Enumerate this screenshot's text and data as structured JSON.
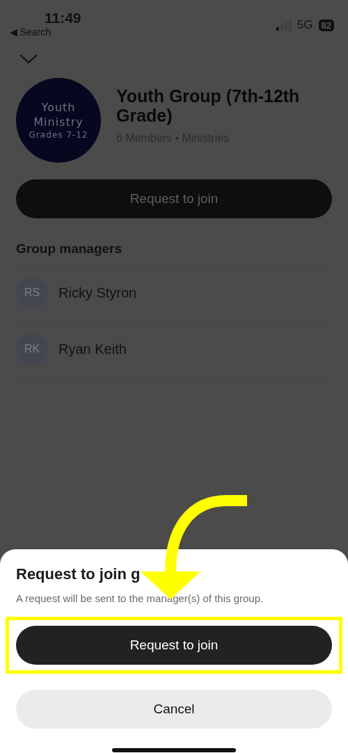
{
  "status_bar": {
    "time": "11:49",
    "back_label": "◀ Search",
    "network": "5G",
    "battery": "82"
  },
  "group": {
    "logo_lines": [
      "Youth",
      "Ministry",
      "Grades 7-12"
    ],
    "title": "Youth Group (7th-12th Grade)",
    "subtitle": "6 Members • Ministries",
    "join_button": "Request to join"
  },
  "managers": {
    "heading": "Group managers",
    "items": [
      {
        "initials": "RS",
        "name": "Ricky Styron"
      },
      {
        "initials": "RK",
        "name": "Ryan Keith"
      }
    ]
  },
  "sheet": {
    "title": "Request to join g",
    "message": "A request will be sent to the manager(s) of this group.",
    "primary_button": "Request to join",
    "cancel_button": "Cancel"
  }
}
